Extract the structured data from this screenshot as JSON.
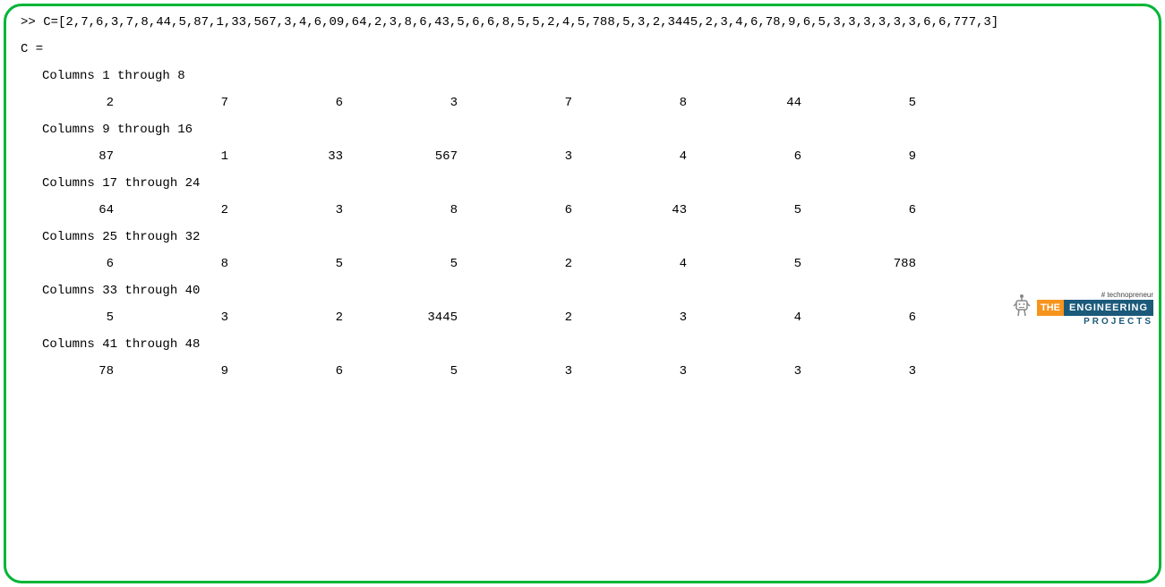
{
  "prompt": ">> ",
  "command": "C=[2,7,6,3,7,8,44,5,87,1,33,567,3,4,6,09,64,2,3,8,6,43,5,6,6,8,5,5,2,4,5,788,5,3,2,3445,2,3,4,6,78,9,6,5,3,3,3,3,3,3,6,6,777,3]",
  "var_echo": "C =",
  "sections": [
    {
      "header": "Columns 1 through 8",
      "values": [
        "2",
        "7",
        "6",
        "3",
        "7",
        "8",
        "44",
        "5"
      ]
    },
    {
      "header": "Columns 9 through 16",
      "values": [
        "87",
        "1",
        "33",
        "567",
        "3",
        "4",
        "6",
        "9"
      ]
    },
    {
      "header": "Columns 17 through 24",
      "values": [
        "64",
        "2",
        "3",
        "8",
        "6",
        "43",
        "5",
        "6"
      ]
    },
    {
      "header": "Columns 25 through 32",
      "values": [
        "6",
        "8",
        "5",
        "5",
        "2",
        "4",
        "5",
        "788"
      ]
    },
    {
      "header": "Columns 33 through 40",
      "values": [
        "5",
        "3",
        "2",
        "3445",
        "2",
        "3",
        "4",
        "6"
      ]
    },
    {
      "header": "Columns 41 through 48",
      "values": [
        "78",
        "9",
        "6",
        "5",
        "3",
        "3",
        "3",
        "3"
      ]
    }
  ],
  "watermark": {
    "tagline": "# technopreneur",
    "the": "THE",
    "engineering": "ENGINEERING",
    "projects": "PROJECTS"
  }
}
